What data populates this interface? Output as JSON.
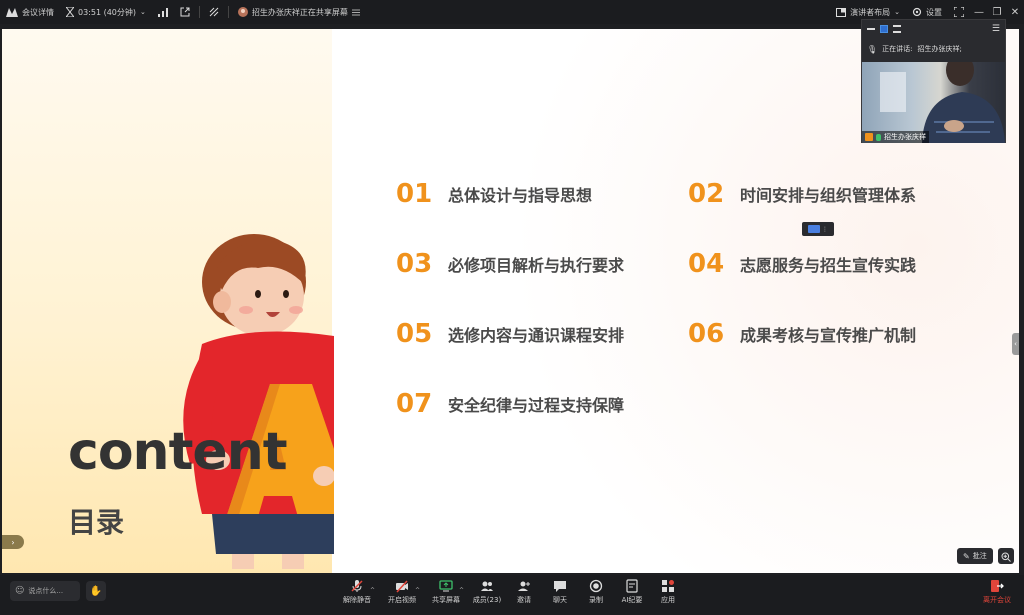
{
  "topbar": {
    "meeting_details": "会议详情",
    "timer": "03:51 (40分钟)",
    "sharing_status": "招生办张庆祥正在共享屏幕",
    "layout": "演讲者布局",
    "settings": "设置"
  },
  "slide": {
    "title": "content",
    "subtitle": "目录",
    "toc": [
      {
        "num": "01",
        "label": "总体设计与指导思想"
      },
      {
        "num": "02",
        "label": "时间安排与组织管理体系"
      },
      {
        "num": "03",
        "label": "必修项目解析与执行要求"
      },
      {
        "num": "04",
        "label": "志愿服务与招生宣传实践"
      },
      {
        "num": "05",
        "label": "选修内容与通识课程安排"
      },
      {
        "num": "06",
        "label": "成果考核与宣传推广机制"
      },
      {
        "num": "07",
        "label": "安全纪律与过程支持保障"
      }
    ],
    "annotate_label": "批注"
  },
  "video_panel": {
    "speaking_label": "正在讲话:",
    "speaking_name": "招生办张庆祥;",
    "participant_name": "招生办张庆祥"
  },
  "bottombar": {
    "chat_placeholder": "说点什么...",
    "controls": [
      {
        "label": "解除静音",
        "icon": "mic-muted-icon"
      },
      {
        "label": "开启视频",
        "icon": "camera-off-icon"
      },
      {
        "label": "共享屏幕",
        "icon": "share-screen-icon"
      },
      {
        "label": "成员(23)",
        "icon": "members-icon"
      },
      {
        "label": "邀请",
        "icon": "invite-icon"
      },
      {
        "label": "聊天",
        "icon": "chat-icon"
      },
      {
        "label": "录制",
        "icon": "record-icon"
      },
      {
        "label": "AI纪要",
        "icon": "ai-notes-icon"
      },
      {
        "label": "应用",
        "icon": "apps-icon"
      }
    ],
    "leave_label": "离开会议"
  },
  "colors": {
    "accent_orange": "#f0921c",
    "leave_red": "#e0453a",
    "bar_bg": "#1b1c1f"
  }
}
